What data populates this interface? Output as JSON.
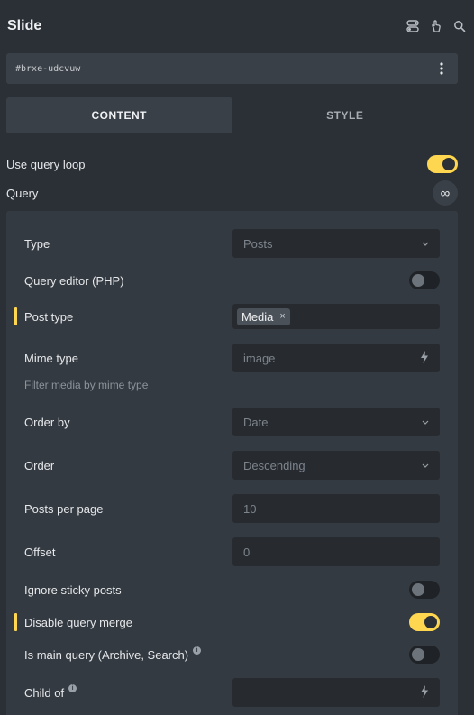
{
  "header": {
    "title": "Slide",
    "icons": [
      "toggle-icon",
      "pointer-hand-icon",
      "search-icon"
    ]
  },
  "element_id": {
    "value": "#brxe-udcvuw",
    "menu_icon": "more-vertical-icon"
  },
  "tabs": [
    {
      "label": "CONTENT",
      "active": true
    },
    {
      "label": "STYLE",
      "active": false
    }
  ],
  "use_query_loop": {
    "label": "Use query loop",
    "enabled": true
  },
  "query": {
    "label": "Query",
    "icon": "infinity-icon"
  },
  "query_panel": {
    "type": {
      "label": "Type",
      "value": "Posts"
    },
    "query_editor": {
      "label": "Query editor (PHP)",
      "enabled": false
    },
    "post_type": {
      "label": "Post type",
      "tag": "Media",
      "remove_glyph": "×"
    },
    "mime_type": {
      "label": "Mime type",
      "placeholder": "image",
      "link": "Filter media by mime type"
    },
    "order_by": {
      "label": "Order by",
      "value": "Date"
    },
    "order": {
      "label": "Order",
      "value": "Descending"
    },
    "posts_per_page": {
      "label": "Posts per page",
      "placeholder": "10"
    },
    "offset": {
      "label": "Offset",
      "placeholder": "0"
    },
    "ignore_sticky": {
      "label": "Ignore sticky posts",
      "enabled": false
    },
    "disable_query_merge": {
      "label": "Disable query merge",
      "enabled": true
    },
    "is_main_query": {
      "label": "Is main query (Archive, Search)",
      "enabled": false
    },
    "child_of": {
      "label": "Child of",
      "placeholder": ""
    }
  },
  "colors": {
    "accent": "#ffd64f",
    "background": "#2b3036",
    "panel": "#343a41",
    "field": "#272b30"
  }
}
